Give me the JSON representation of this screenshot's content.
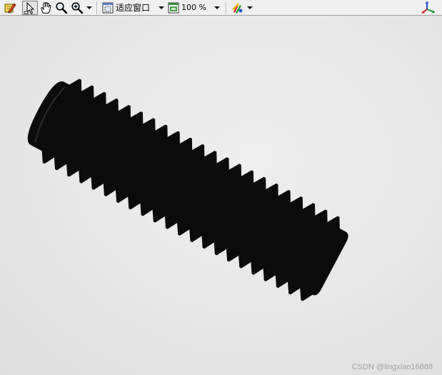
{
  "toolbar": {
    "edit_tool_icon": "pencil-edit-icon",
    "pointer_tool_icon": "pointer-arrow-icon",
    "pan_tool_icon": "hand-pan-icon",
    "magnify_tool_icon": "magnifier-icon",
    "zoom_tool_icon": "zoom-in-icon",
    "fit_mode_label": "适应窗口",
    "zoom_level_label": "100 %",
    "color_tool_icon": "color-palette-icon",
    "axes_tool_icon": "xyz-axes-icon"
  },
  "image_view": {
    "subject": "threaded-screw-silhouette",
    "watermark": "CSDN @lingxiao16888"
  }
}
